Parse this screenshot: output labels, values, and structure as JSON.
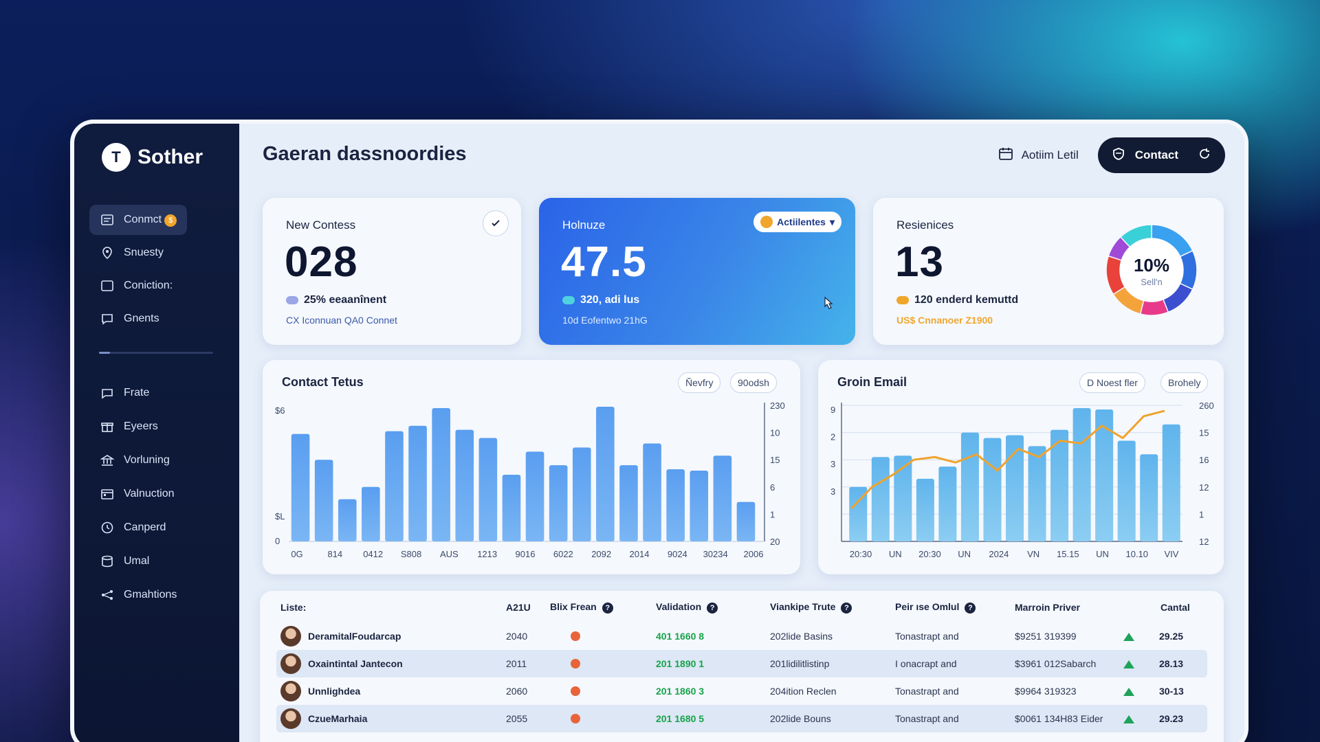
{
  "app": {
    "name": "Sother",
    "logo_letter": "T"
  },
  "page_title": "Gaeran dassnoordies",
  "header": {
    "account_label": "Aotiim Letil",
    "contact_label": "Contact"
  },
  "sidebar": {
    "items": [
      {
        "label": "Conmct",
        "icon": "list-icon",
        "badge": "$",
        "active": true
      },
      {
        "label": "Snuesty",
        "icon": "location-pin-icon"
      },
      {
        "label": "Coniction:",
        "icon": "square-icon"
      },
      {
        "label": "Gnents",
        "icon": "chat-bubble-icon"
      },
      {
        "label": "Frate",
        "icon": "message-icon"
      },
      {
        "label": "Eyeers",
        "icon": "gift-icon"
      },
      {
        "label": "Vorluning",
        "icon": "bank-icon"
      },
      {
        "label": "Valnuction",
        "icon": "calendar-icon"
      },
      {
        "label": "Canperd",
        "icon": "clock-icon"
      },
      {
        "label": "Umal",
        "icon": "database-icon"
      },
      {
        "label": "Gmahtions",
        "icon": "network-icon"
      }
    ]
  },
  "stats": {
    "card1": {
      "label": "New Contess",
      "value": "028",
      "sub": "25% eeaanînent",
      "foot": "CX Iconnuan QA0 Connet",
      "dot_color": "#9aa6e6"
    },
    "card2": {
      "label": "Holnuze",
      "value": "47.5",
      "pill": "Actiilentes",
      "sub": "320, adi lus",
      "foot": "10d Eofentwo 21hG",
      "dot_color": "#4fd2e0"
    },
    "card3": {
      "label": "Resienices",
      "value": "13",
      "sub": "120 enderd kemuttd",
      "foot": "US$ Cnnanoer Z1900",
      "dot_color": "#f0a62d",
      "foot_color": "#f0a62d",
      "donut_percent": "10%",
      "donut_label": "Sell'n",
      "donut_segments": [
        {
          "value": 18,
          "color": "#3aa0f0"
        },
        {
          "value": 14,
          "color": "#2f6fe0"
        },
        {
          "value": 12,
          "color": "#3c4fd0"
        },
        {
          "value": 10,
          "color": "#e83a8a"
        },
        {
          "value": 12,
          "color": "#f4a23a"
        },
        {
          "value": 14,
          "color": "#e8423a"
        },
        {
          "value": 8,
          "color": "#a04ad8"
        },
        {
          "value": 12,
          "color": "#3ad0d8"
        }
      ]
    }
  },
  "chart_data": [
    {
      "type": "bar",
      "title": "Contact Tetus",
      "chips": [
        "Ñevfry",
        "90odsh"
      ],
      "y_left_ticks": [
        "$6",
        "$L",
        "0"
      ],
      "y_right_ticks": [
        "230",
        "10",
        "15",
        "6",
        "1",
        "20"
      ],
      "categories": [
        "0G",
        "814",
        "0412",
        "S808",
        "AUS",
        "1213",
        "9016",
        "6022",
        "2092",
        "2014",
        "9024",
        "30234",
        "2006"
      ],
      "values": [
        79,
        60,
        31,
        40,
        81,
        85,
        98,
        82,
        76,
        49,
        66,
        56,
        69,
        99,
        56,
        72,
        53,
        52,
        63,
        29
      ],
      "ylim": [
        0,
        100
      ]
    },
    {
      "type": "bar",
      "title": "Groin Email",
      "chips": [
        "D Noest fler",
        "Brohely"
      ],
      "y_left_ticks": [
        "9",
        "2",
        "3",
        "3"
      ],
      "y_right_ticks": [
        "260",
        "15",
        "16",
        "12",
        "1",
        "12"
      ],
      "categories": [
        "20:30",
        "UN",
        "20:30",
        "UN",
        "2024",
        "VN",
        "15.15",
        "UN",
        "10.10",
        "VIV"
      ],
      "values": [
        40,
        62,
        63,
        46,
        55,
        80,
        76,
        78,
        70,
        82,
        98,
        97,
        74,
        64,
        86
      ],
      "line_values": [
        24,
        40,
        49,
        60,
        62,
        58,
        64,
        52,
        68,
        62,
        74,
        72,
        85,
        76,
        92,
        96
      ],
      "line_color": "#f0a32d",
      "ylim": [
        0,
        100
      ]
    }
  ],
  "table": {
    "headers": [
      "Liste:",
      "A21U",
      "Blix Frean",
      "Validation",
      "Viankipe Trute",
      "Peir ıse Omlul",
      "Marroin Priver",
      "Cantal"
    ],
    "rows": [
      {
        "name": "DeramitalFoudarcap",
        "year": "2040",
        "validation": "401 1660 8",
        "trute": "202lide Basins",
        "omlul": "Tonastrapt and",
        "priver": "$9251 319399",
        "cantal": "29.25"
      },
      {
        "name": "Oxaintintal Jantecon",
        "year": "2011",
        "validation": "201 1890 1",
        "trute": "201lidilitlistinp",
        "omlul": "I onacrapt and",
        "priver": "$3961 012Sabarch",
        "cantal": "28.13"
      },
      {
        "name": "Unnlighdea",
        "year": "2060",
        "validation": "201 1860 3",
        "trute": "204ition Reclen",
        "omlul": "Tonastrapt and",
        "priver": "$9964 319323",
        "cantal": "30-13"
      },
      {
        "name": "CzueMarhaia",
        "year": "2055",
        "validation": "201 1680 5",
        "trute": "202lide Bouns",
        "omlul": "Tonastrapt and",
        "priver": "$0061 134H83 Eider",
        "cantal": "29.23"
      }
    ]
  }
}
